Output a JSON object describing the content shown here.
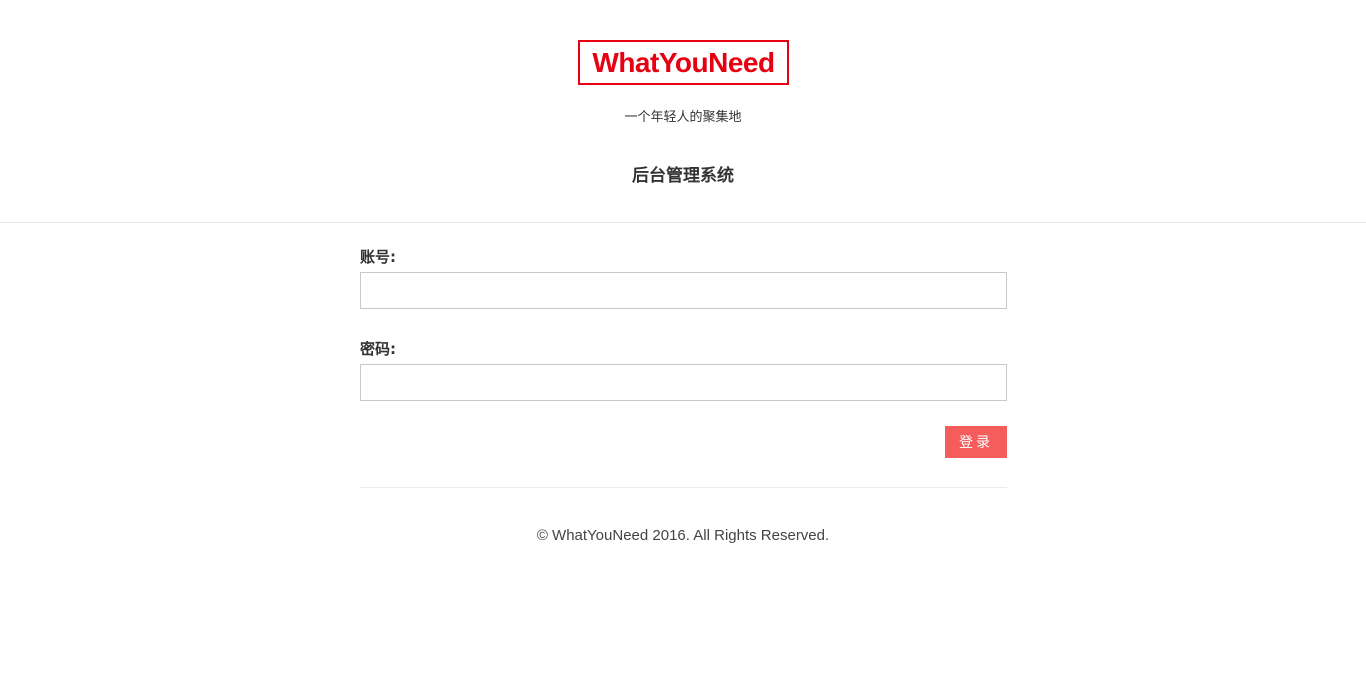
{
  "header": {
    "logo_text": "WhatYouNeed",
    "tagline": "一个年轻人的聚集地",
    "system_title": "后台管理系统"
  },
  "form": {
    "account_label": "账号:",
    "account_value": "",
    "password_label": "密码:",
    "password_value": "",
    "login_button_label": "登录"
  },
  "footer": {
    "copyright": "© WhatYouNeed 2016. All Rights Reserved."
  },
  "colors": {
    "brand_red": "#e60012",
    "button_red": "#f55c5c"
  }
}
